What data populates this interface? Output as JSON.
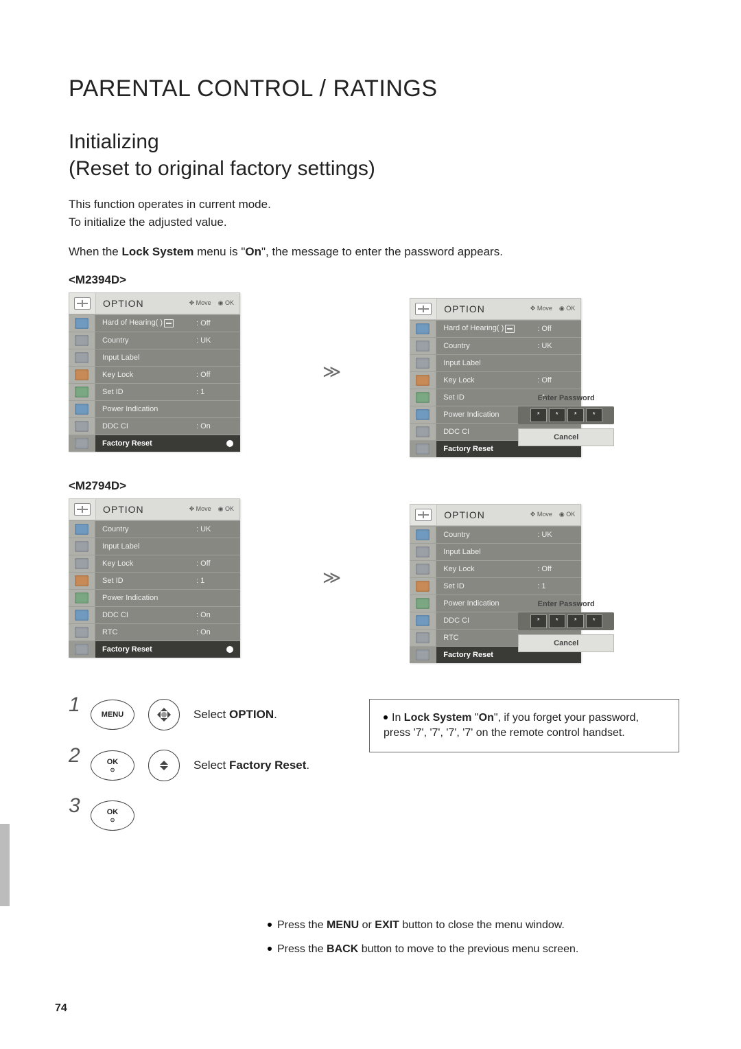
{
  "page_number": "74",
  "heading": "PARENTAL CONTROL / RATINGS",
  "subheading_line1": "Initializing",
  "subheading_line2": "(Reset to original factory settings)",
  "intro_line1": "This function operates in current mode.",
  "intro_line2": "To initialize the adjusted value.",
  "lock_note_prefix": "When the ",
  "lock_note_strong1": "Lock System",
  "lock_note_mid": " menu is \"",
  "lock_note_strong2": "On",
  "lock_note_suffix": "\", the message to enter the password appears.",
  "model_a": "<M2394D>",
  "model_b": "<M2794D>",
  "osd_title": "OPTION",
  "osd_hint_move": "Move",
  "osd_hint_ok": "OK",
  "menu_a": {
    "rows": [
      {
        "label": "Hard of Hearing(    )",
        "value": ": Off"
      },
      {
        "label": "Country",
        "value": ": UK"
      },
      {
        "label": "Input Label",
        "value": ""
      },
      {
        "label": "Key Lock",
        "value": ": Off"
      },
      {
        "label": "Set ID",
        "value": ": 1"
      },
      {
        "label": "Power Indication",
        "value": ""
      },
      {
        "label": "DDC CI",
        "value": ": On"
      },
      {
        "label": "Factory Reset",
        "value": ""
      }
    ]
  },
  "menu_b": {
    "rows": [
      {
        "label": "Country",
        "value": ": UK"
      },
      {
        "label": "Input Label",
        "value": ""
      },
      {
        "label": "Key Lock",
        "value": ": Off"
      },
      {
        "label": "Set ID",
        "value": ": 1"
      },
      {
        "label": "Power Indication",
        "value": ""
      },
      {
        "label": "DDC CI",
        "value": ": On"
      },
      {
        "label": "RTC",
        "value": ": On"
      },
      {
        "label": "Factory Reset",
        "value": ""
      }
    ]
  },
  "enter_password": "Enter Password",
  "pw_mask": "*",
  "cancel": "Cancel",
  "steps": {
    "n1": "1",
    "n2": "2",
    "n3": "3",
    "btn_menu": "MENU",
    "btn_ok": "OK",
    "text1_a": "Select ",
    "text1_b": "OPTION",
    "text1_c": ".",
    "text2_a": "Select ",
    "text2_b": "Factory Reset",
    "text2_c": "."
  },
  "tip_box": {
    "a": "In ",
    "b": "Lock System",
    "c": " \"",
    "d": "On",
    "e": "\", if you forget your password, press '7', '7', '7', '7' on the remote control handset."
  },
  "footnote1_a": "Press the ",
  "footnote1_b": "MENU",
  "footnote1_c": " or ",
  "footnote1_d": "EXIT",
  "footnote1_e": " button to close the menu window.",
  "footnote2_a": "Press the ",
  "footnote2_b": "BACK",
  "footnote2_c": " button to move to the previous menu screen."
}
